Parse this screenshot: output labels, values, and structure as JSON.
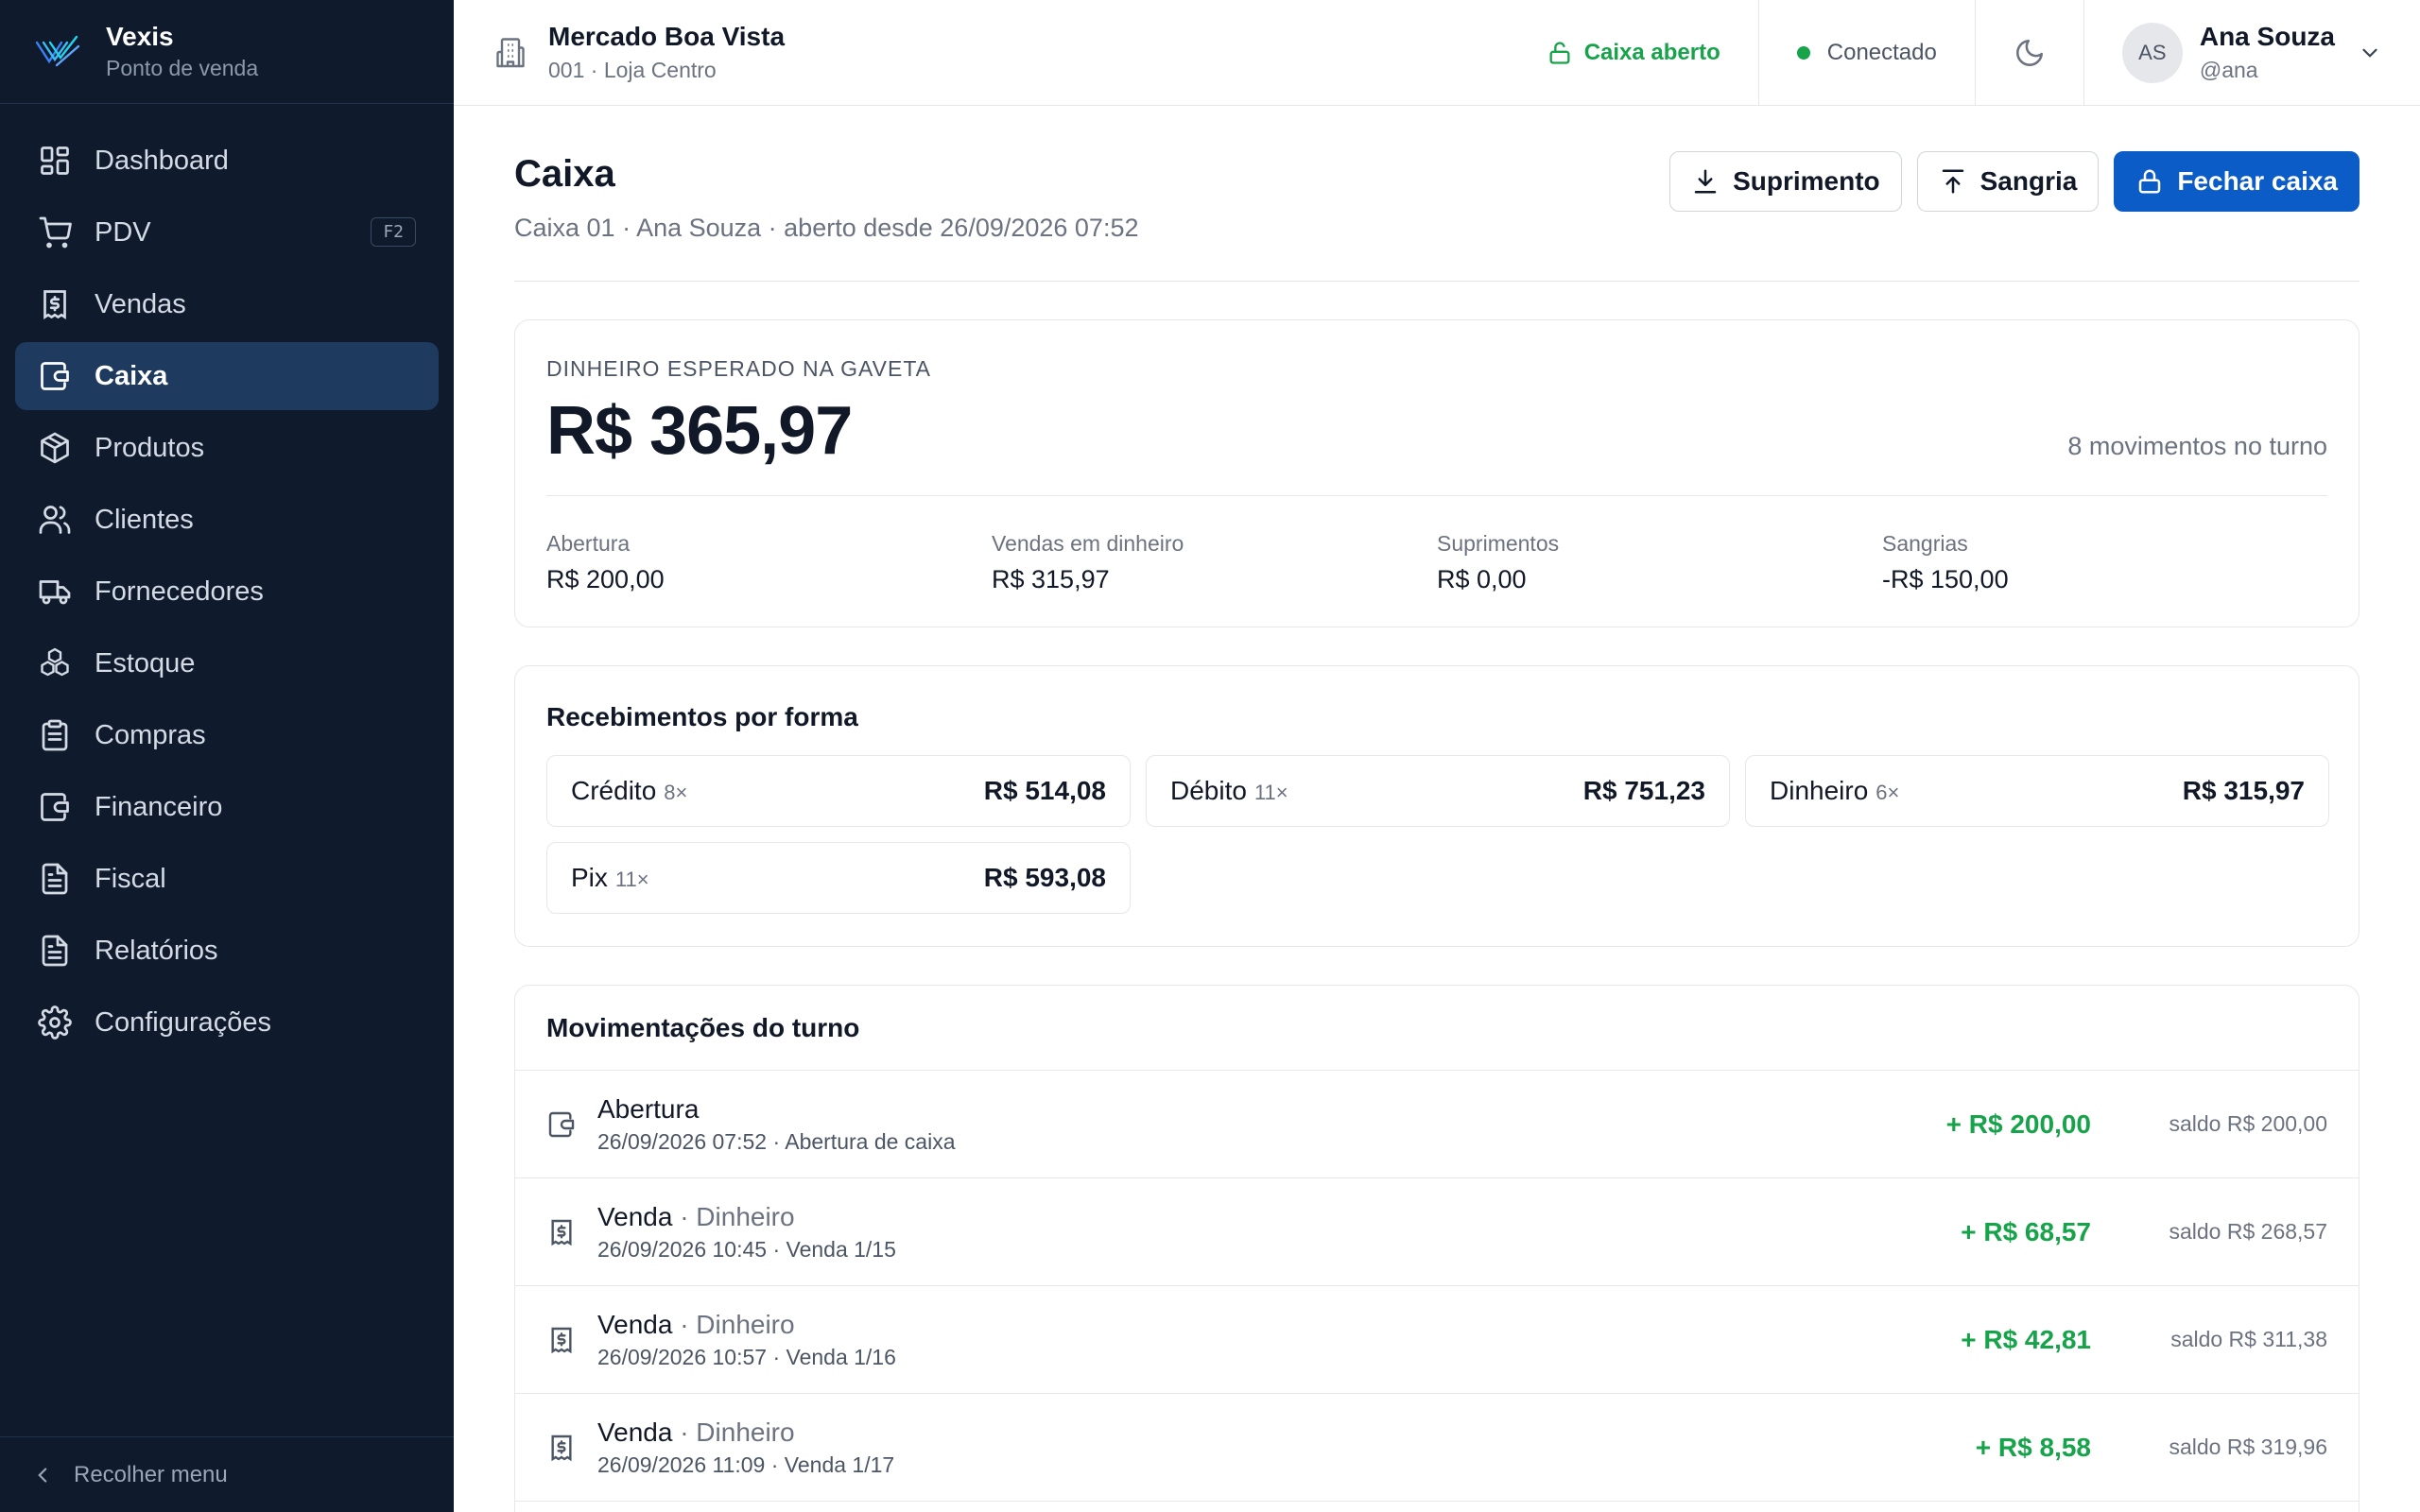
{
  "brand": {
    "name": "Vexis",
    "subtitle": "Ponto de venda"
  },
  "sidebar": {
    "items": [
      {
        "label": "Dashboard",
        "icon": "dashboard-icon"
      },
      {
        "label": "PDV",
        "icon": "cart-icon",
        "shortcut": "F2"
      },
      {
        "label": "Vendas",
        "icon": "receipt-icon"
      },
      {
        "label": "Caixa",
        "icon": "wallet-icon",
        "active": true
      },
      {
        "label": "Produtos",
        "icon": "package-icon"
      },
      {
        "label": "Clientes",
        "icon": "users-icon"
      },
      {
        "label": "Fornecedores",
        "icon": "truck-icon"
      },
      {
        "label": "Estoque",
        "icon": "boxes-icon"
      },
      {
        "label": "Compras",
        "icon": "clipboard-icon"
      },
      {
        "label": "Financeiro",
        "icon": "wallet-icon"
      },
      {
        "label": "Fiscal",
        "icon": "document-icon"
      },
      {
        "label": "Relatórios",
        "icon": "document-icon"
      },
      {
        "label": "Configurações",
        "icon": "gear-icon"
      }
    ],
    "collapse_label": "Recolher menu"
  },
  "topbar": {
    "store_name": "Mercado Boa Vista",
    "store_sub": "001 · Loja Centro",
    "caixa_status": "Caixa aberto",
    "connection": "Conectado",
    "user": {
      "initials": "AS",
      "name": "Ana Souza",
      "handle": "@ana"
    }
  },
  "page": {
    "title": "Caixa",
    "subtitle": "Caixa 01 · Ana Souza · aberto desde 26/09/2026 07:52",
    "actions": {
      "suprimento": "Suprimento",
      "sangria": "Sangria",
      "fechar": "Fechar caixa"
    }
  },
  "cash": {
    "label": "DINHEIRO ESPERADO NA GAVETA",
    "amount": "R$ 365,97",
    "moves": "8 movimentos no turno",
    "stats": [
      {
        "label": "Abertura",
        "value": "R$ 200,00"
      },
      {
        "label": "Vendas em dinheiro",
        "value": "R$ 315,97"
      },
      {
        "label": "Suprimentos",
        "value": "R$ 0,00"
      },
      {
        "label": "Sangrias",
        "value": "-R$ 150,00"
      }
    ]
  },
  "receipts": {
    "title": "Recebimentos por forma",
    "items": [
      {
        "name": "Crédito",
        "count": "8×",
        "value": "R$ 514,08"
      },
      {
        "name": "Débito",
        "count": "11×",
        "value": "R$ 751,23"
      },
      {
        "name": "Dinheiro",
        "count": "6×",
        "value": "R$ 315,97"
      },
      {
        "name": "Pix",
        "count": "11×",
        "value": "R$ 593,08"
      }
    ]
  },
  "movements": {
    "title": "Movimentações do turno",
    "rows": [
      {
        "icon": "wallet-icon",
        "kind": "Abertura",
        "method": "",
        "detail": "26/09/2026 07:52 · Abertura de caixa",
        "amount": "+ R$ 200,00",
        "balance": "saldo R$ 200,00"
      },
      {
        "icon": "receipt-icon",
        "kind": "Venda",
        "method": " · Dinheiro",
        "detail": "26/09/2026 10:45 · Venda 1/15",
        "amount": "+ R$ 68,57",
        "balance": "saldo R$ 268,57"
      },
      {
        "icon": "receipt-icon",
        "kind": "Venda",
        "method": " · Dinheiro",
        "detail": "26/09/2026 10:57 · Venda 1/16",
        "amount": "+ R$ 42,81",
        "balance": "saldo R$ 311,38"
      },
      {
        "icon": "receipt-icon",
        "kind": "Venda",
        "method": " · Dinheiro",
        "detail": "26/09/2026 11:09 · Venda 1/17",
        "amount": "+ R$ 8,58",
        "balance": "saldo R$ 319,96"
      }
    ]
  },
  "colors": {
    "sidebar_bg": "#0f1b2d",
    "active_bg": "#1e3a5f",
    "primary": "#0b5cc6",
    "positive": "#16a34a"
  }
}
